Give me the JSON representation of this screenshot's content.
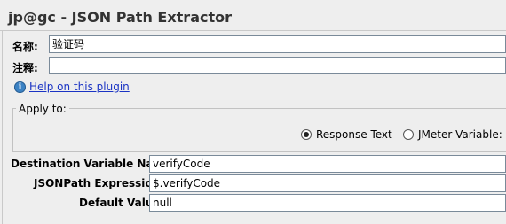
{
  "window": {
    "title": "jp@gc - JSON Path Extractor"
  },
  "name_field": {
    "label": "名称:",
    "value": "验证码"
  },
  "comment_field": {
    "label": "注释:",
    "value": ""
  },
  "help": {
    "icon": "info-icon",
    "link_text": "Help on this plugin"
  },
  "apply_to": {
    "legend": "Apply to:",
    "options": [
      {
        "label": "Response Text",
        "selected": true
      },
      {
        "label": "JMeter Variable:",
        "selected": false
      }
    ]
  },
  "form": {
    "dest_var": {
      "label": "Destination Variable Name:",
      "value": "verifyCode"
    },
    "jsonpath": {
      "label": "JSONPath Expression:",
      "value": "$.verifyCode"
    },
    "default_value": {
      "label": "Default Value:",
      "value": "null"
    }
  }
}
